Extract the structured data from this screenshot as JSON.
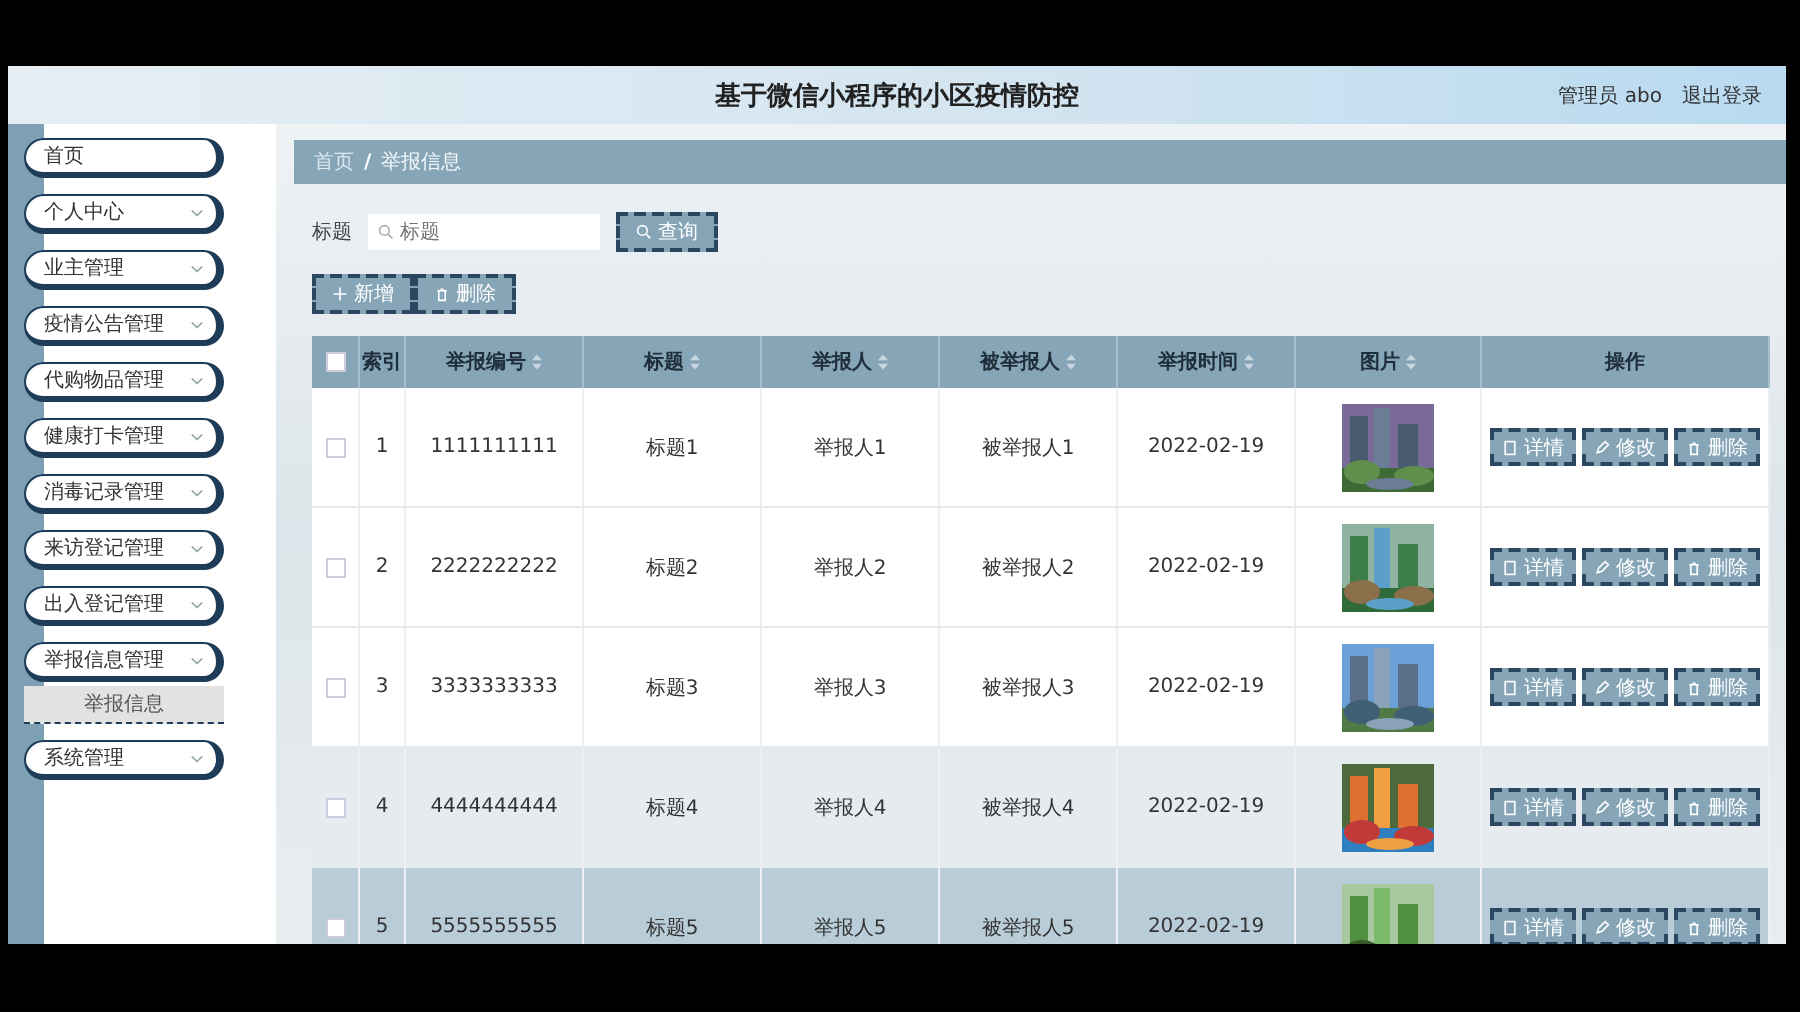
{
  "header": {
    "title": "基于微信小程序的小区疫情防控",
    "user": "管理员 abo",
    "logout": "退出登录"
  },
  "sidebar": {
    "items": [
      {
        "label": "首页",
        "kind": "link"
      },
      {
        "label": "个人中心",
        "kind": "menu"
      },
      {
        "label": "业主管理",
        "kind": "menu"
      },
      {
        "label": "疫情公告管理",
        "kind": "menu"
      },
      {
        "label": "代购物品管理",
        "kind": "menu"
      },
      {
        "label": "健康打卡管理",
        "kind": "menu"
      },
      {
        "label": "消毒记录管理",
        "kind": "menu"
      },
      {
        "label": "来访登记管理",
        "kind": "menu"
      },
      {
        "label": "出入登记管理",
        "kind": "menu"
      },
      {
        "label": "举报信息管理",
        "kind": "menu",
        "children": [
          {
            "label": "举报信息",
            "selected": true
          }
        ]
      },
      {
        "label": "系统管理",
        "kind": "menu"
      }
    ]
  },
  "breadcrumb": {
    "items": [
      "首页",
      "举报信息"
    ],
    "separator": "/"
  },
  "search": {
    "label": "标题",
    "placeholder": "标题",
    "button": "查询"
  },
  "toolbar": [
    {
      "label": "新增",
      "kind": "add"
    },
    {
      "label": "删除",
      "kind": "delete"
    }
  ],
  "table": {
    "header_checked": false,
    "columns": [
      {
        "label": "索引",
        "sortable": false
      },
      {
        "label": "举报编号",
        "sortable": true
      },
      {
        "label": "标题",
        "sortable": true
      },
      {
        "label": "举报人",
        "sortable": true
      },
      {
        "label": "被举报人",
        "sortable": true
      },
      {
        "label": "举报时间",
        "sortable": true
      },
      {
        "label": "图片",
        "sortable": true
      },
      {
        "label": "操作",
        "sortable": false
      }
    ],
    "rows": [
      {
        "checked": false,
        "striped": false,
        "hovered": false,
        "cells": [
          "1",
          "1111111111",
          "标题1",
          "举报人1",
          "被举报人1",
          "2022-02-19"
        ],
        "actions": [
          {
            "label": "详情",
            "kind": "detail"
          },
          {
            "label": "修改",
            "kind": "edit"
          },
          {
            "label": "删除",
            "kind": "delete"
          }
        ]
      },
      {
        "checked": false,
        "striped": false,
        "hovered": false,
        "cells": [
          "2",
          "2222222222",
          "标题2",
          "举报人2",
          "被举报人2",
          "2022-02-19"
        ],
        "actions": [
          {
            "label": "详情",
            "kind": "detail"
          },
          {
            "label": "修改",
            "kind": "edit"
          },
          {
            "label": "删除",
            "kind": "delete"
          }
        ]
      },
      {
        "checked": false,
        "striped": false,
        "hovered": false,
        "cells": [
          "3",
          "3333333333",
          "标题3",
          "举报人3",
          "被举报人3",
          "2022-02-19"
        ],
        "actions": [
          {
            "label": "详情",
            "kind": "detail"
          },
          {
            "label": "修改",
            "kind": "edit"
          },
          {
            "label": "删除",
            "kind": "delete"
          }
        ]
      },
      {
        "checked": false,
        "striped": true,
        "hovered": false,
        "cells": [
          "4",
          "4444444444",
          "标题4",
          "举报人4",
          "被举报人4",
          "2022-02-19"
        ],
        "actions": [
          {
            "label": "详情",
            "kind": "detail"
          },
          {
            "label": "修改",
            "kind": "edit"
          },
          {
            "label": "删除",
            "kind": "delete"
          }
        ]
      },
      {
        "checked": false,
        "striped": false,
        "hovered": true,
        "cells": [
          "5",
          "5555555555",
          "标题5",
          "举报人5",
          "被举报人5",
          "2022-02-19"
        ],
        "actions": [
          {
            "label": "详情",
            "kind": "detail"
          },
          {
            "label": "修改",
            "kind": "edit"
          },
          {
            "label": "删除",
            "kind": "delete"
          }
        ]
      }
    ]
  }
}
